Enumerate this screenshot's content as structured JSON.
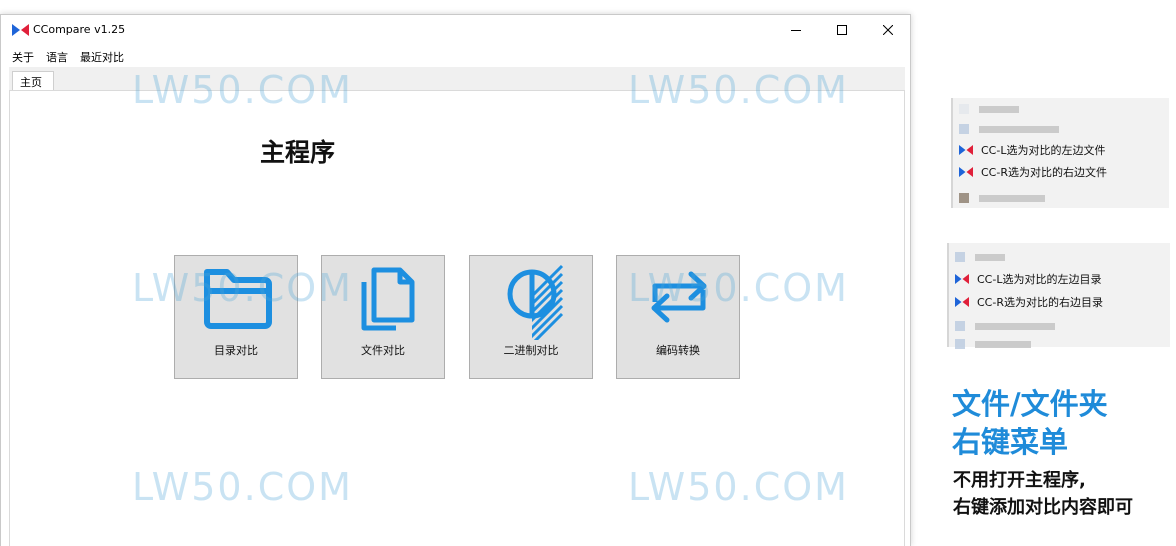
{
  "window": {
    "title": "CCompare  v1.25",
    "controls": {
      "minimize": "minimize",
      "maximize": "maximize",
      "close": "close"
    }
  },
  "menu": {
    "about": "关于",
    "language": "语言",
    "recent": "最近对比"
  },
  "tabs": [
    {
      "label": "主页",
      "active": true
    }
  ],
  "main": {
    "title": "主程序",
    "tiles": [
      {
        "label": "目录对比",
        "icon": "folder-icon"
      },
      {
        "label": "文件对比",
        "icon": "files-icon"
      },
      {
        "label": "二进制对比",
        "icon": "half-circle-icon"
      },
      {
        "label": "编码转换",
        "icon": "swap-arrows-icon"
      }
    ]
  },
  "watermark": "LW50.COM",
  "context_menu_file": {
    "items": [
      {
        "label": "CC-L选为对比的左边文件",
        "icon": "ccompare-icon"
      },
      {
        "label": "CC-R选为对比的右边文件",
        "icon": "ccompare-icon"
      }
    ]
  },
  "context_menu_folder": {
    "items": [
      {
        "label": "CC-L选为对比的左边目录",
        "icon": "ccompare-icon"
      },
      {
        "label": "CC-R选为对比的右边目录",
        "icon": "ccompare-icon"
      }
    ]
  },
  "promo": {
    "headline_line1": "文件/文件夹",
    "headline_line2": "右键菜单",
    "subline1": "不用打开主程序,",
    "subline2": "右键添加对比内容即可"
  },
  "colors": {
    "accent_blue": "#1f8bd9",
    "icon_blue": "#1d8fe0",
    "tile_bg": "#e1e1e1",
    "logo_red": "#e0203a",
    "logo_blue": "#1e64d8"
  }
}
